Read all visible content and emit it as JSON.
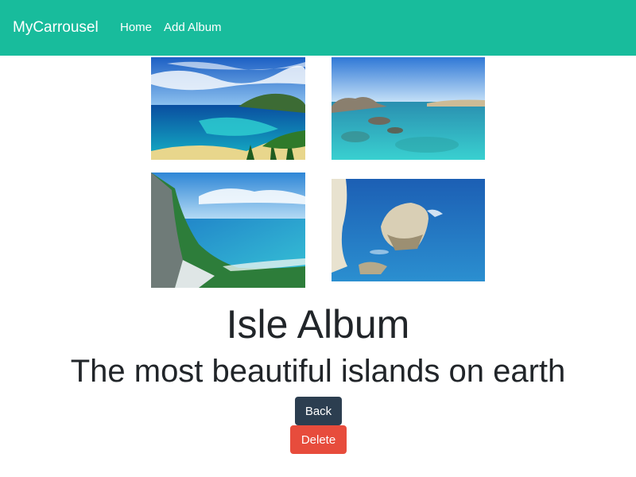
{
  "navbar": {
    "brand": "MyCarrousel",
    "links": [
      "Home",
      "Add Album"
    ],
    "background": "#18bc9c"
  },
  "album": {
    "photos": [
      {
        "icon": "tropical-bay-photo"
      },
      {
        "icon": "rocky-lagoon-photo"
      },
      {
        "icon": "coastal-cliff-photo"
      },
      {
        "icon": "sea-stack-photo"
      }
    ],
    "title": "Isle Album",
    "description": "The most beautiful islands on earth"
  },
  "actions": {
    "back_label": "Back",
    "delete_label": "Delete",
    "back_color": "#2c3e50",
    "delete_color": "#e74c3c"
  }
}
